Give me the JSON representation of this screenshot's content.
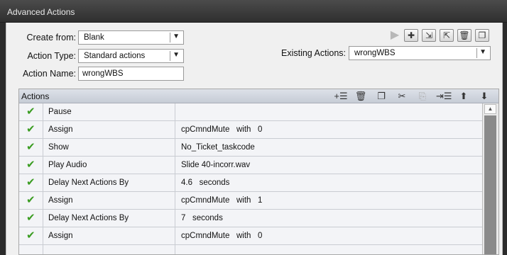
{
  "window": {
    "title": "Advanced Actions"
  },
  "form": {
    "create_from_label": "Create from:",
    "create_from_value": "Blank",
    "action_type_label": "Action Type:",
    "action_type_value": "Standard actions",
    "action_name_label": "Action Name:",
    "action_name_value": "wrongWBS",
    "existing_actions_label": "Existing Actions:",
    "existing_actions_value": "wrongWBS"
  },
  "toolbar_icons": [
    "play-icon",
    "add-icon",
    "import-icon",
    "export-icon",
    "delete-icon",
    "duplicate-icon"
  ],
  "grid": {
    "header": "Actions",
    "header_icons": [
      "add-row-icon",
      "trash-icon",
      "copy-icon",
      "cut-icon",
      "paste-icon",
      "insert-icon",
      "move-up-icon",
      "move-down-icon"
    ],
    "rows": [
      {
        "action": "Pause",
        "detail": ""
      },
      {
        "action": "Assign",
        "detail": "cpCmndMute   with   0"
      },
      {
        "action": "Show",
        "detail": "No_Ticket_taskcode"
      },
      {
        "action": "Play Audio",
        "detail": "Slide 40-incorr.wav"
      },
      {
        "action": "Delay Next Actions By",
        "detail": "4.6   seconds"
      },
      {
        "action": "Assign",
        "detail": "cpCmndMute   with   1"
      },
      {
        "action": "Delay Next Actions By",
        "detail": "7   seconds"
      },
      {
        "action": "Assign",
        "detail": "cpCmndMute   with   0"
      },
      {
        "action": "",
        "detail": ""
      }
    ]
  },
  "colors": {
    "check": "#3a9c21",
    "titlebar": "#3a3a3a",
    "panel": "#f0f0f0"
  }
}
